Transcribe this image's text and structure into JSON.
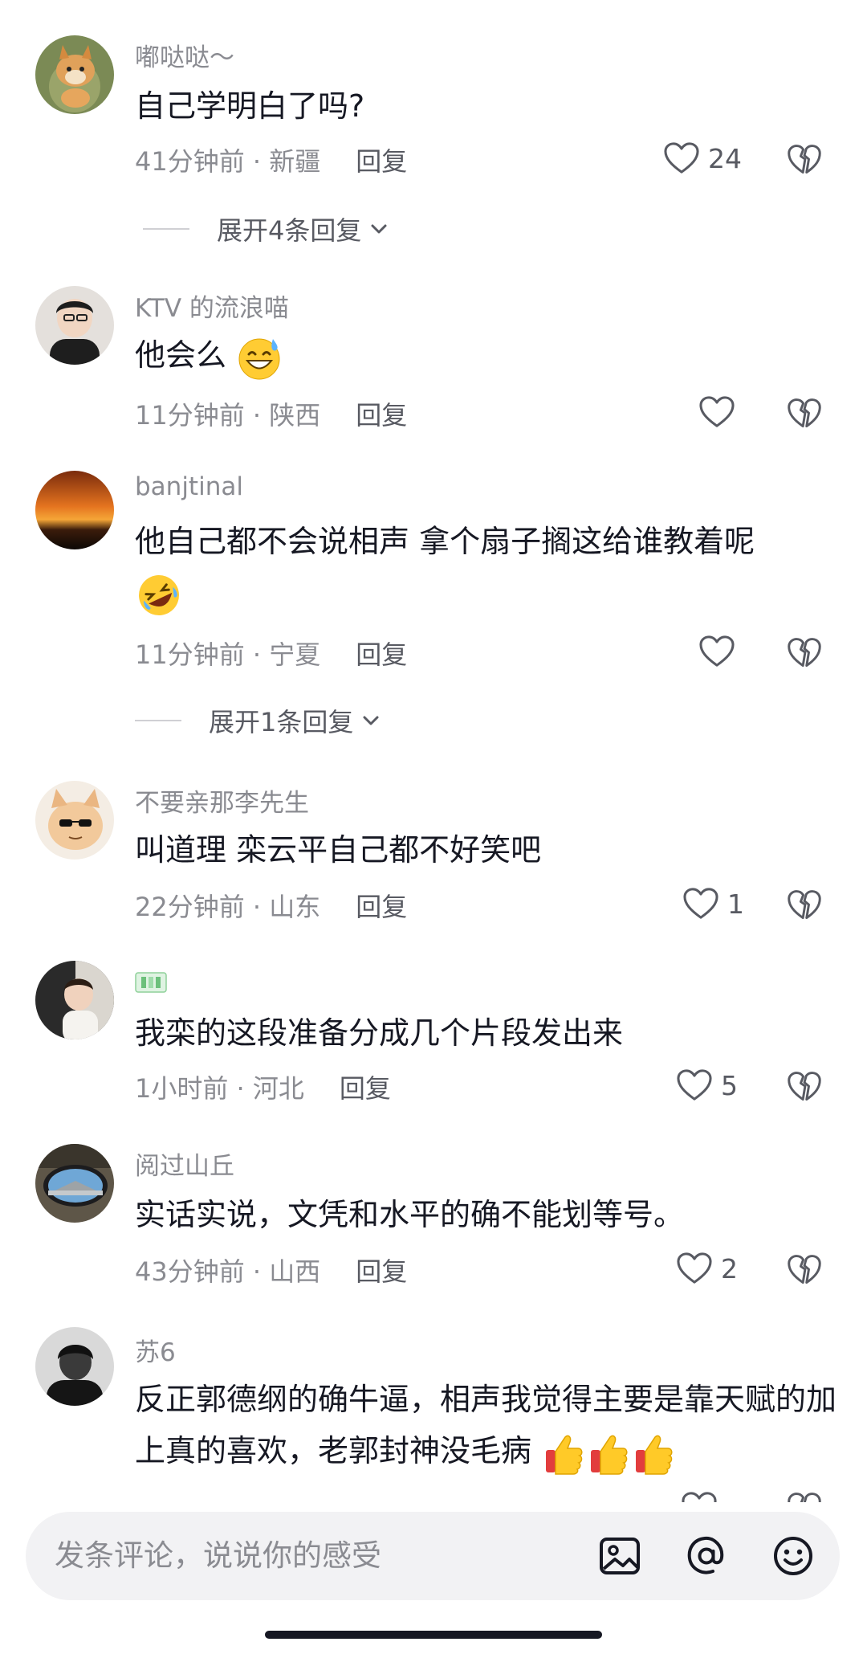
{
  "comments": [
    {
      "user": "嘟哒哒～",
      "text": "自己学明白了吗?",
      "time": "41分钟前",
      "location": "新疆",
      "reply": "回复",
      "likes": "24",
      "expand": "展开4条回复"
    },
    {
      "user": "KTV 的流浪喵",
      "text": "他会么",
      "time": "11分钟前",
      "location": "陕西",
      "reply": "回复",
      "likes": ""
    },
    {
      "user": "banjtinal",
      "text": "他自己都不会说相声 拿个扇子搁这给谁教着呢",
      "time": "11分钟前",
      "location": "宁夏",
      "reply": "回复",
      "likes": "",
      "expand": "展开1条回复"
    },
    {
      "user": "不要亲那李先生",
      "text": "叫道理 栾云平自己都不好笑吧",
      "time": "22分钟前",
      "location": "山东",
      "reply": "回复",
      "likes": "1"
    },
    {
      "user": "",
      "text": "我栾的这段准备分成几个片段发出来",
      "time": "1小时前",
      "location": "河北",
      "reply": "回复",
      "likes": "5"
    },
    {
      "user": "阅过山丘",
      "text": "实话实说，文凭和水平的确不能划等号。",
      "time": "43分钟前",
      "location": "山西",
      "reply": "回复",
      "likes": "2"
    },
    {
      "user": "苏6",
      "text": "反正郭德纲的确牛逼，相声我觉得主要是靠天赋的加上真的喜欢，老郭封神没毛病",
      "time": "",
      "location": "",
      "reply": "",
      "likes": ""
    }
  ],
  "meta_separator": " · ",
  "input": {
    "placeholder": "发条评论，说说你的感受"
  },
  "icons": {
    "like": "heart-outline-icon",
    "dislike": "broken-heart-icon",
    "expand": "chevron-down-icon",
    "image": "image-icon",
    "mention": "at-icon",
    "emoji": "smiley-icon"
  },
  "colors": {
    "primary_text": "#161823",
    "secondary_text": "#8a8b91",
    "action_text": "#585a62",
    "input_bg": "#f2f2f4"
  }
}
